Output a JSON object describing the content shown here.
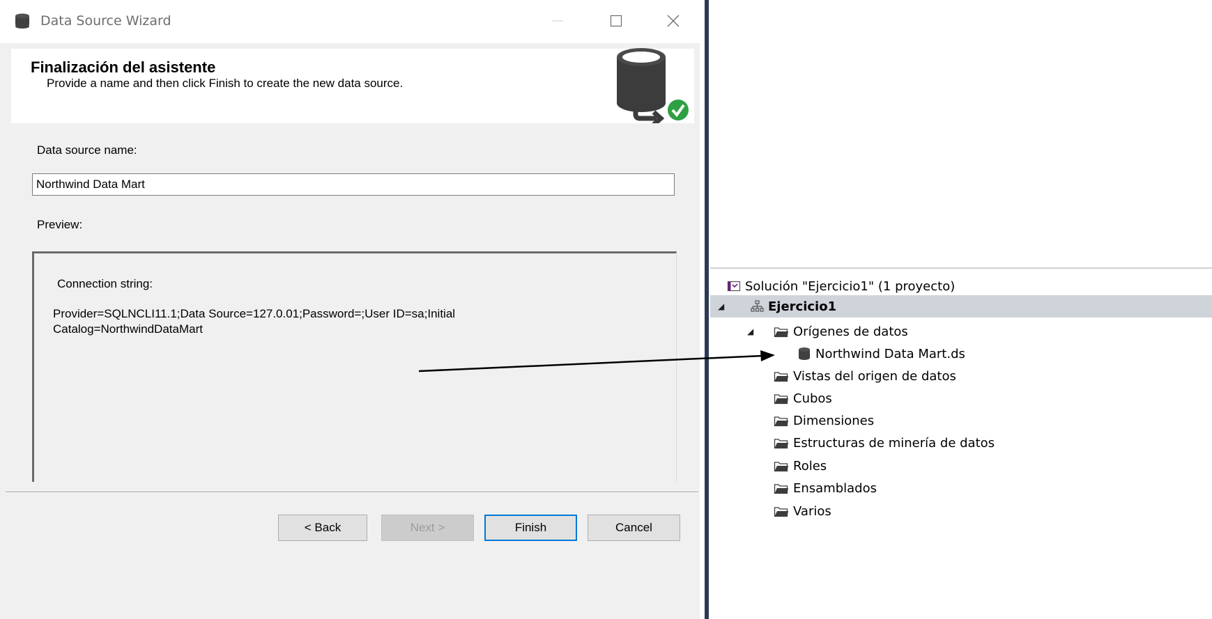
{
  "wizard": {
    "window_title": "Data Source Wizard",
    "header": {
      "title": "Finalización del asistente",
      "subtitle": "Provide a name and then click Finish to create the new data source."
    },
    "name_label": "Data source name:",
    "name_value": "Northwind Data Mart",
    "preview_label": "Preview:",
    "connection_label": "Connection string:",
    "connection_value": "Provider=SQLNCLI11.1;Data Source=127.0.01;Password=;User ID=sa;Initial Catalog=NorthwindDataMart",
    "buttons": {
      "back": "< Back",
      "next": "Next >",
      "finish": "Finish",
      "cancel": "Cancel"
    }
  },
  "solution_explorer": {
    "solution": "Solución \"Ejercicio1\"  (1 proyecto)",
    "project": "Ejercicio1",
    "data_sources_folder": "Orígenes de datos",
    "data_source_item": "Northwind Data Mart.ds",
    "folders": [
      "Vistas del origen de datos",
      "Cubos",
      "Dimensiones",
      "Estructuras de minería de datos",
      "Roles",
      "Ensamblados",
      "Varios"
    ]
  },
  "colors": {
    "accent_focus": "#0078d7",
    "success_check": "#2ea043",
    "selected_row": "#cfd3da",
    "divider": "#2b3a55"
  }
}
